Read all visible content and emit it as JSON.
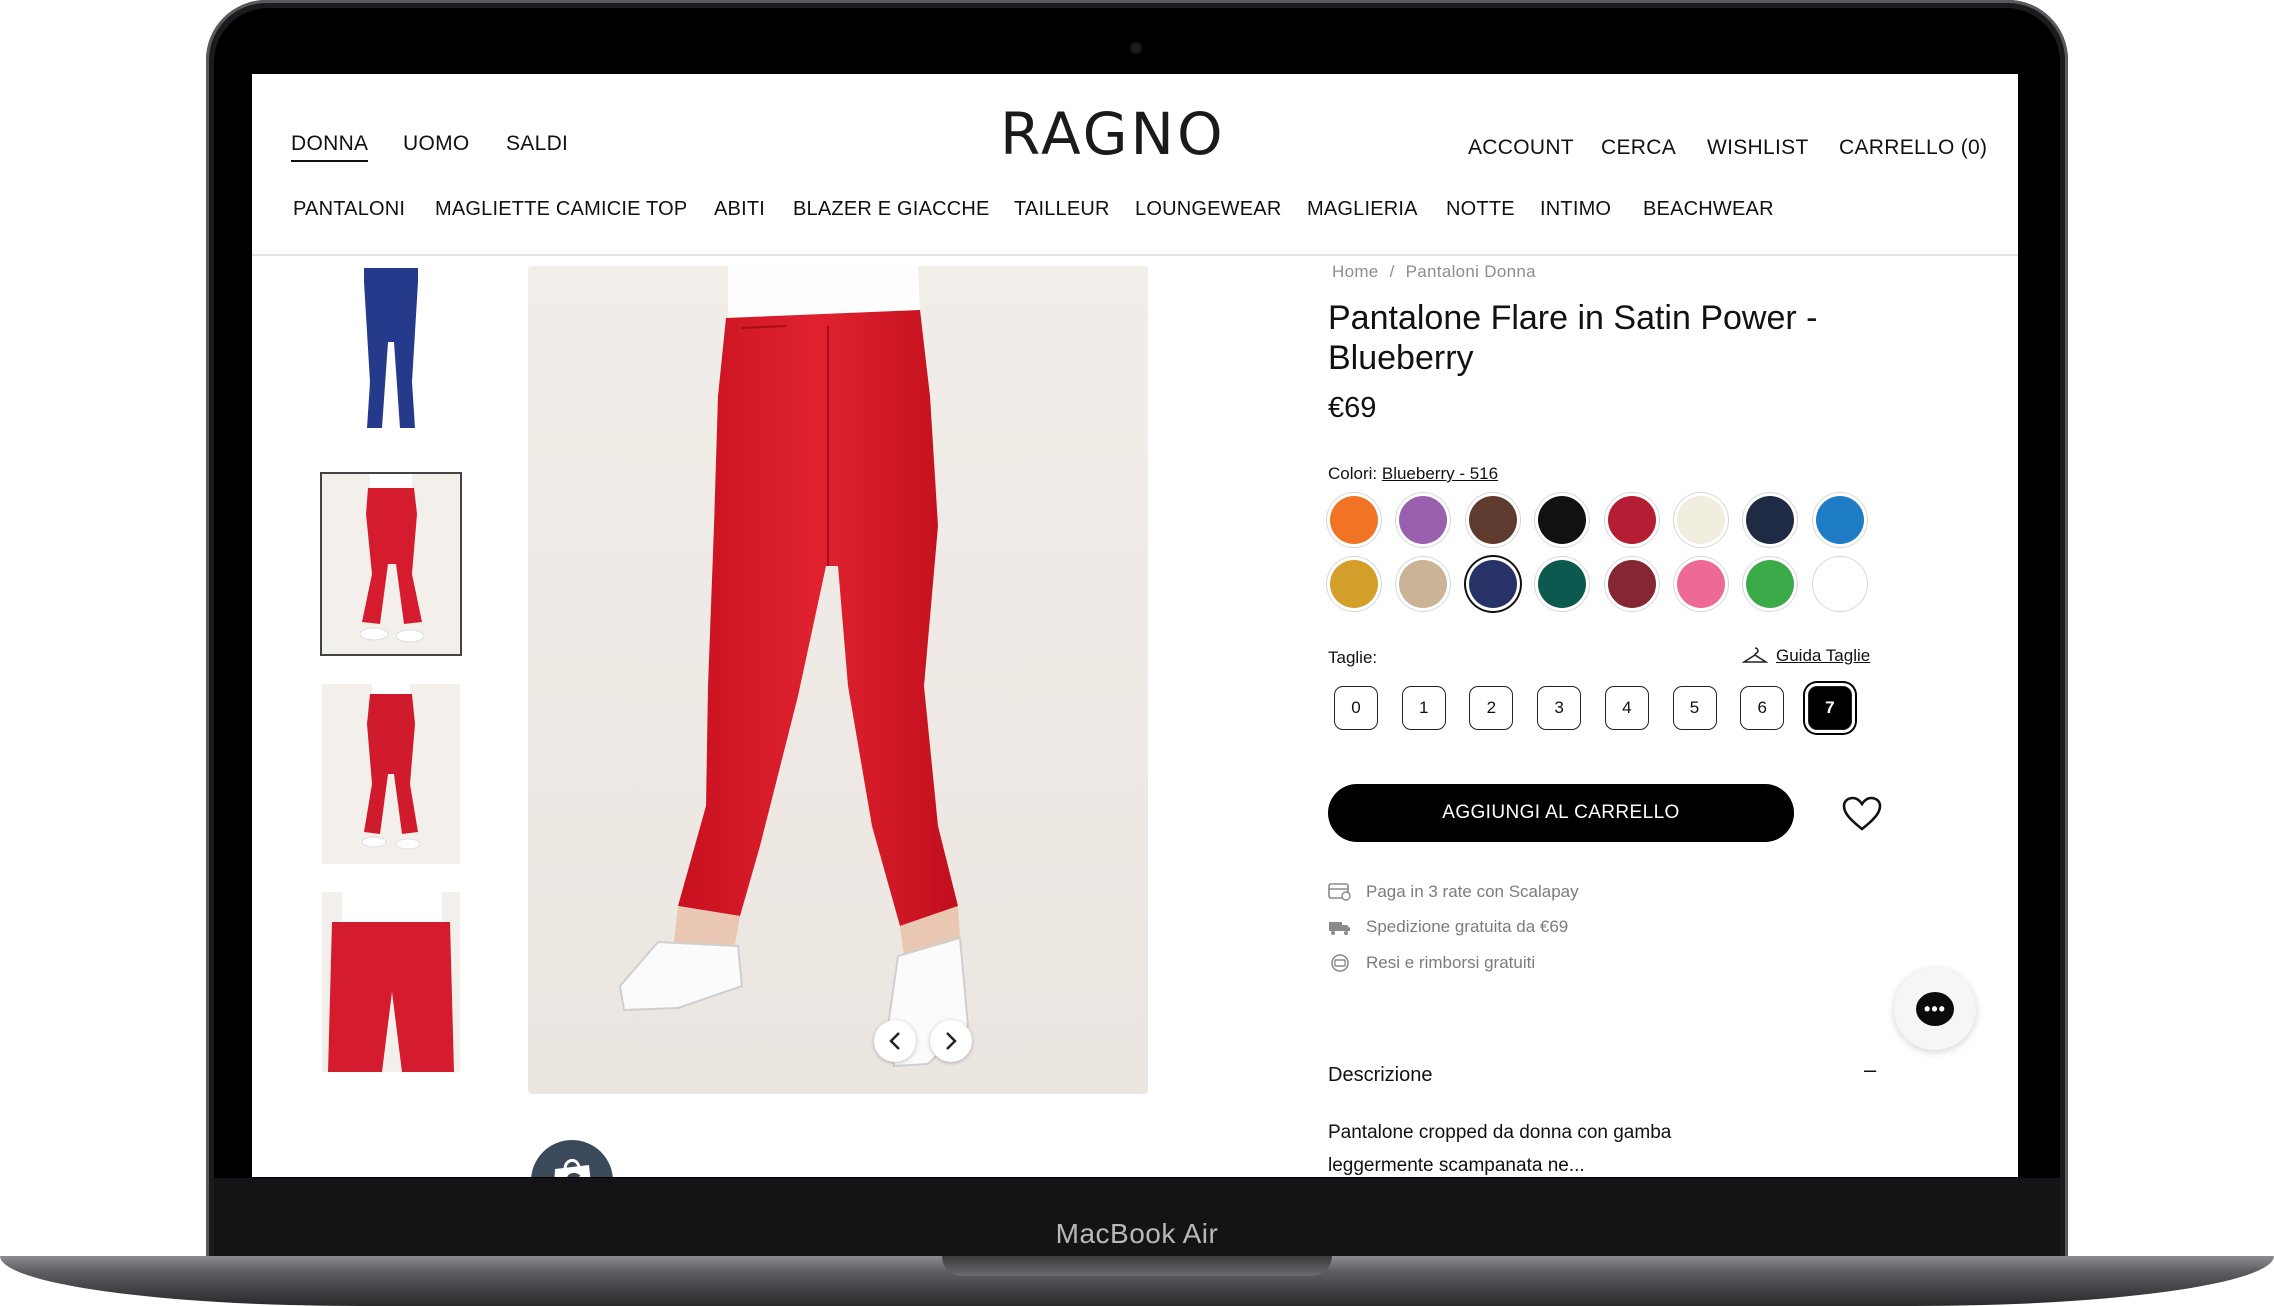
{
  "device_label": "MacBook Air",
  "nav": {
    "left": [
      "DONNA",
      "UOMO",
      "SALDI"
    ],
    "logo": "RAGNO",
    "right": [
      "ACCOUNT",
      "CERCA",
      "WISHLIST",
      "CARRELLO (0)"
    ],
    "categories": [
      "PANTALONI",
      "MAGLIETTE CAMICIE TOP",
      "ABITI",
      "BLAZER E GIACCHE",
      "TAILLEUR",
      "LOUNGEWEAR",
      "MAGLIERIA",
      "NOTTE",
      "INTIMO",
      "BEACHWEAR"
    ]
  },
  "breadcrumb": {
    "home": "Home",
    "sep": "/",
    "current": "Pantaloni Donna"
  },
  "product": {
    "title": "Pantalone Flare in Satin Power - Blueberry",
    "price": "€69",
    "colors_label": "Colori:",
    "selected_color": "Blueberry - 516",
    "swatches": [
      "#f07424",
      "#9b5fb0",
      "#5f3a2e",
      "#111111",
      "#b51d34",
      "#f2eedf",
      "#1f2b45",
      "#1e7cc4",
      "#d39f2a",
      "#cbb395",
      "#273366",
      "#0c5a4f",
      "#862635",
      "#ec6a93",
      "#3caa48",
      "#ffffff"
    ],
    "selected_swatch_index": 10,
    "sizes_label": "Taglie:",
    "size_guide": "Guida Taglie",
    "sizes": [
      "0",
      "1",
      "2",
      "3",
      "4",
      "5",
      "6",
      "7"
    ],
    "selected_size": "7",
    "add_to_cart": "AGGIUNGI AL CARRELLO",
    "info": [
      "Paga in 3 rate con Scalapay",
      "Spedizione gratuita da €69",
      "Resi e rimborsi gratuiti"
    ],
    "description_heading": "Descrizione",
    "description_toggle": "–",
    "description_text": "Pantalone cropped da donna con gamba leggermente scampanata ne..."
  },
  "chat_icon": "•••"
}
